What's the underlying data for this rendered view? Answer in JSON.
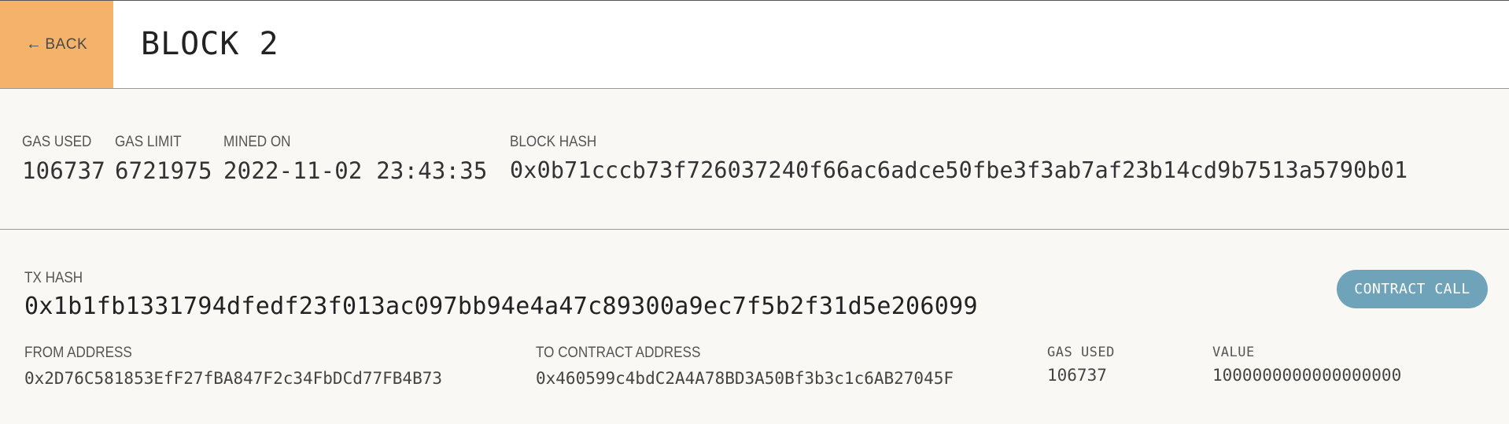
{
  "header": {
    "back_label": "BACK",
    "back_arrow": "←",
    "title": "BLOCK 2"
  },
  "block": {
    "gas_used_label": "GAS USED",
    "gas_used": "106737",
    "gas_limit_label": "GAS LIMIT",
    "gas_limit": "6721975",
    "mined_on_label": "MINED ON",
    "mined_on": "2022-11-02 23:43:35",
    "block_hash_label": "BLOCK HASH",
    "block_hash": "0x0b71cccb73f726037240f66ac6adce50fbe3f3ab7af23b14cd9b7513a5790b01"
  },
  "transaction": {
    "tx_hash_label": "TX HASH",
    "tx_hash": "0x1b1fb1331794dfedf23f013ac097bb94e4a47c89300a9ec7f5b2f31d5e206099",
    "type_badge": "CONTRACT CALL",
    "from_label": "FROM ADDRESS",
    "from": "0x2D76C581853EfF27fBA847F2c34FbDCd77FB4B73",
    "to_label": "TO CONTRACT ADDRESS",
    "to": "0x460599c4bdC2A4A78BD3A50Bf3b3c1c6AB27045F",
    "gas_used_label": "GAS USED",
    "gas_used": "106737",
    "value_label": "VALUE",
    "value": "1000000000000000000"
  },
  "colors": {
    "back_button": "#f4b26b",
    "badge": "#6fa3ba",
    "background": "#f9f8f5"
  }
}
